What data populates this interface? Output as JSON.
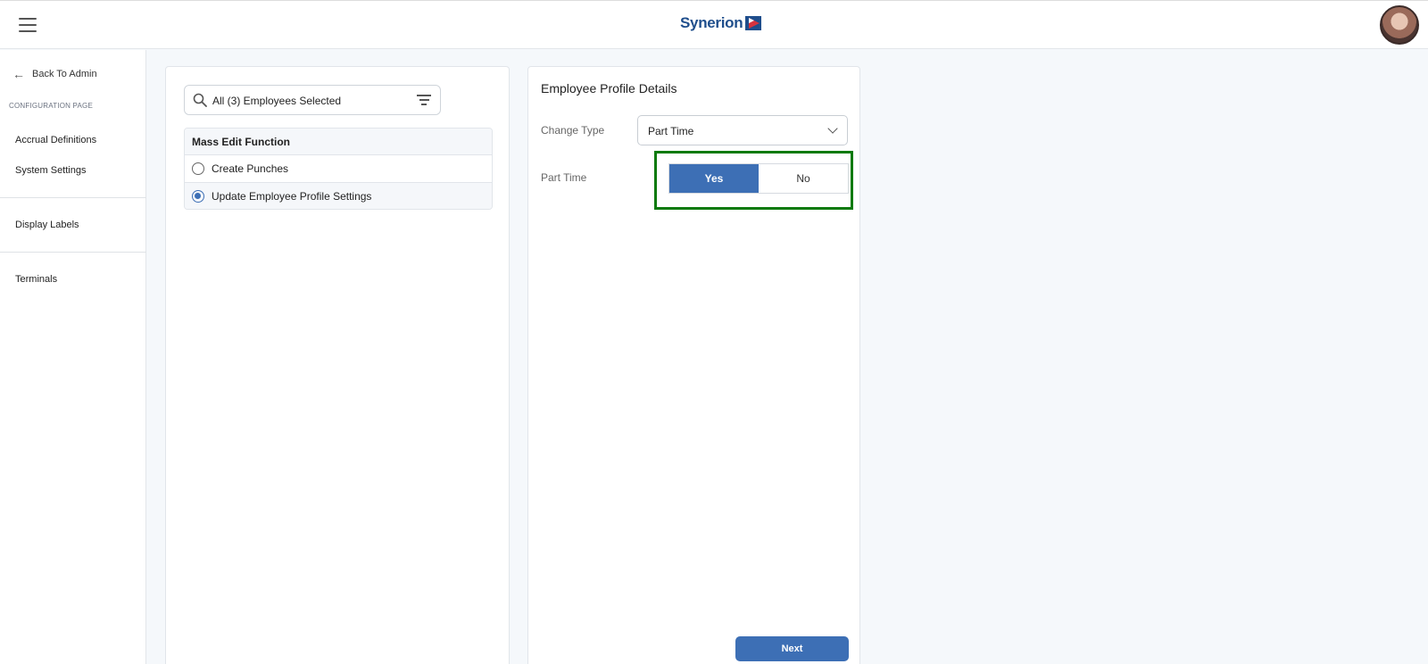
{
  "header": {
    "brand": "Synerion",
    "menu_icon": "hamburger-menu-icon",
    "avatar_icon": "user-avatar"
  },
  "sidebar": {
    "back_label": "Back To Admin",
    "section_title": "CONFIGURATION PAGE",
    "items": [
      {
        "label": "Accrual Definitions"
      },
      {
        "label": "System Settings"
      },
      {
        "label": "Display Labels"
      },
      {
        "label": "Terminals"
      }
    ]
  },
  "left_panel": {
    "search_value": "All (3) Employees Selected",
    "table_header": "Mass Edit Function",
    "options": [
      {
        "label": "Create Punches",
        "selected": false
      },
      {
        "label": "Update Employee Profile Settings",
        "selected": true
      }
    ]
  },
  "right_panel": {
    "title": "Employee Profile Details",
    "change_type_label": "Change Type",
    "change_type_value": "Part Time",
    "part_time_label": "Part Time",
    "yes_label": "Yes",
    "no_label": "No",
    "part_time_selected": "Yes",
    "next_label": "Next"
  },
  "colors": {
    "accent": "#3d6fb5",
    "brand_text": "#1f4e8c",
    "highlight_border": "#0c7a0c",
    "logo_red": "#d6343f"
  }
}
